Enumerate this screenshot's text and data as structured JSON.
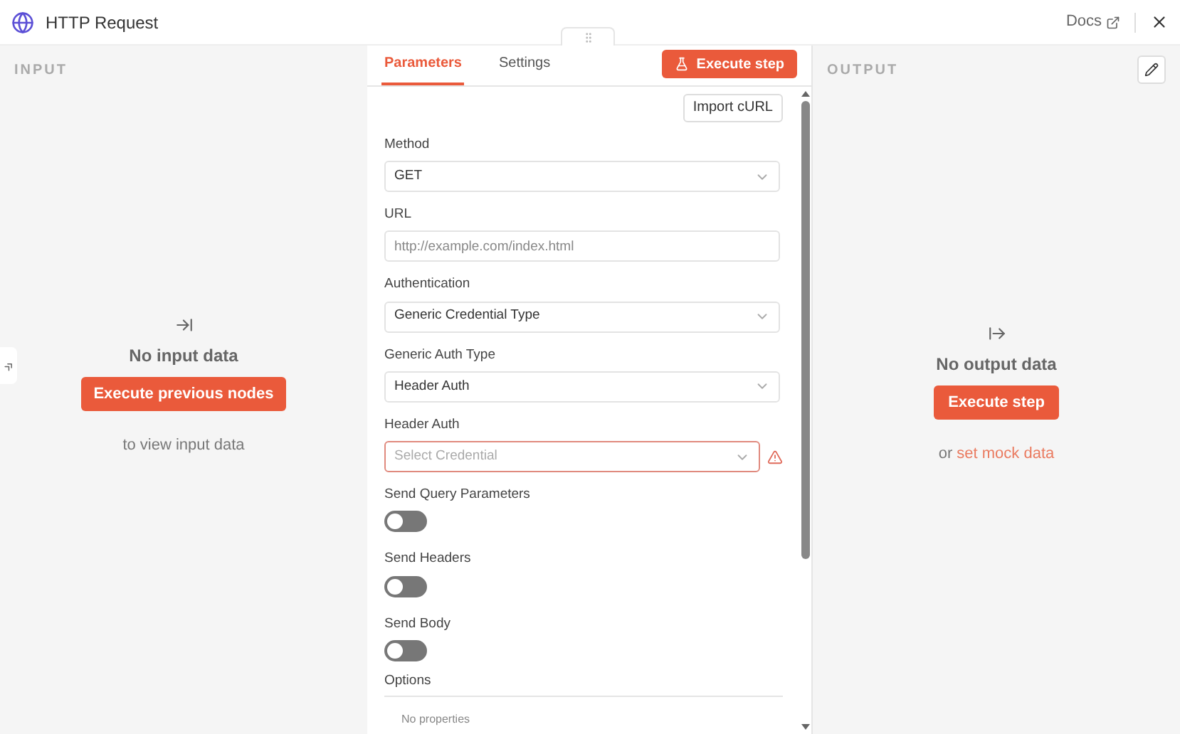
{
  "window": {
    "title": "HTTP Request",
    "docs_link": "Docs"
  },
  "input_panel": {
    "title": "INPUT",
    "message": "No input data",
    "button": "Execute previous nodes",
    "hint": "to view input data"
  },
  "tabs": [
    {
      "label": "Parameters",
      "selected": true
    },
    {
      "label": "Settings",
      "selected": false
    }
  ],
  "execute_button": "Execute step",
  "import_button": "Import cURL",
  "fields": [
    {
      "kind": "select",
      "label": "Method",
      "value": "GET"
    },
    {
      "kind": "input",
      "label": "URL",
      "placeholder": "http://example.com/index.html"
    },
    {
      "kind": "select",
      "label": "Authentication",
      "value": "Generic Credential Type"
    },
    {
      "kind": "select",
      "label": "Generic Auth Type",
      "value": "Header Auth"
    },
    {
      "kind": "select",
      "label": "Header Auth",
      "placeholder": "Select Credential",
      "error": true
    },
    {
      "kind": "toggle",
      "label": "Send Query Parameters",
      "on": false
    },
    {
      "kind": "toggle",
      "label": "Send Headers",
      "on": false
    },
    {
      "kind": "toggle",
      "label": "Send Body",
      "on": false
    }
  ],
  "options": {
    "label": "Options",
    "empty_text": "No properties"
  },
  "output_panel": {
    "title": "OUTPUT",
    "message": "No output data",
    "button": "Execute step",
    "hint_prefix": "or",
    "hint_link": "set mock data"
  }
}
